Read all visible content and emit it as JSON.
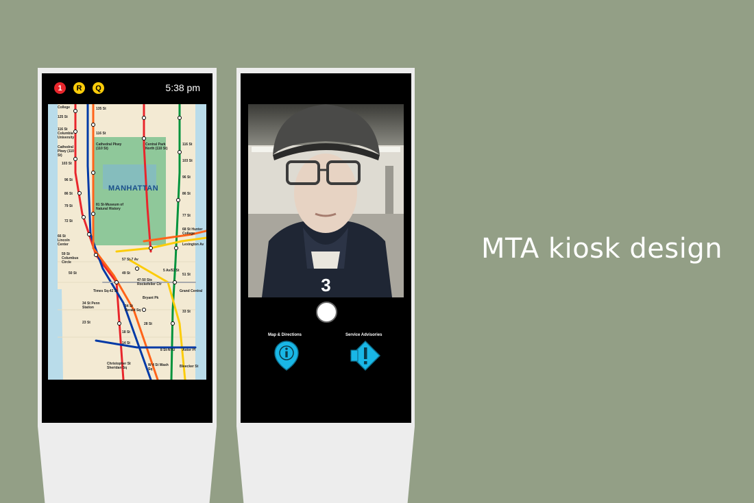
{
  "kiosk_map": {
    "status_bar": {
      "lines": [
        {
          "label": "1",
          "color": "#e8262c",
          "icon": "line-1-badge"
        },
        {
          "label": "R",
          "color": "#fccc0a",
          "icon": "line-r-badge"
        },
        {
          "label": "Q",
          "color": "#fccc0a",
          "icon": "line-q-badge"
        }
      ],
      "time": "5:38 pm"
    },
    "map": {
      "borough_label": "MANHATTAN",
      "stations": [
        "College",
        "125 St",
        "116 St Columbia University",
        "Cathedral Pkwy (110 St)",
        "103 St",
        "96 St",
        "86 St",
        "79 St",
        "72 St",
        "66 St Lincoln Center",
        "59 St Columbus Circle",
        "50 St",
        "Times Sq-42 St",
        "34 St Penn Station",
        "23 St",
        "18 St",
        "14 St",
        "Christopher St Sheridan Sq",
        "135 St",
        "116 St",
        "Cathedral Pkwy (110 St)",
        "81 St-Museum of Natural History",
        "57 St-7 Av",
        "49 St",
        "47-50 Sts Rockefeller Ctr",
        "Bryant Pk",
        "34 St Herald Sq",
        "28 St",
        "8 St-NYU",
        "W 4 St Wash Sq",
        "Central Park North (110 St)",
        "116 St",
        "103 St",
        "96 St",
        "86 St",
        "77 St",
        "68 St Hunter College",
        "Lexington Av",
        "5 Av/53 St",
        "51 St",
        "Grand Central",
        "33 St",
        "Astor Pl",
        "Bleecker St"
      ]
    }
  },
  "kiosk_camera": {
    "countdown": "3",
    "nav": {
      "map_directions": "Map & Directions",
      "service_advisories": "Service Advisories"
    }
  },
  "title": "MTA kiosk design",
  "colors": {
    "background": "#939f86",
    "kiosk_body": "#ededed",
    "screen": "#000000",
    "accent_cyan": "#19b7e6"
  }
}
